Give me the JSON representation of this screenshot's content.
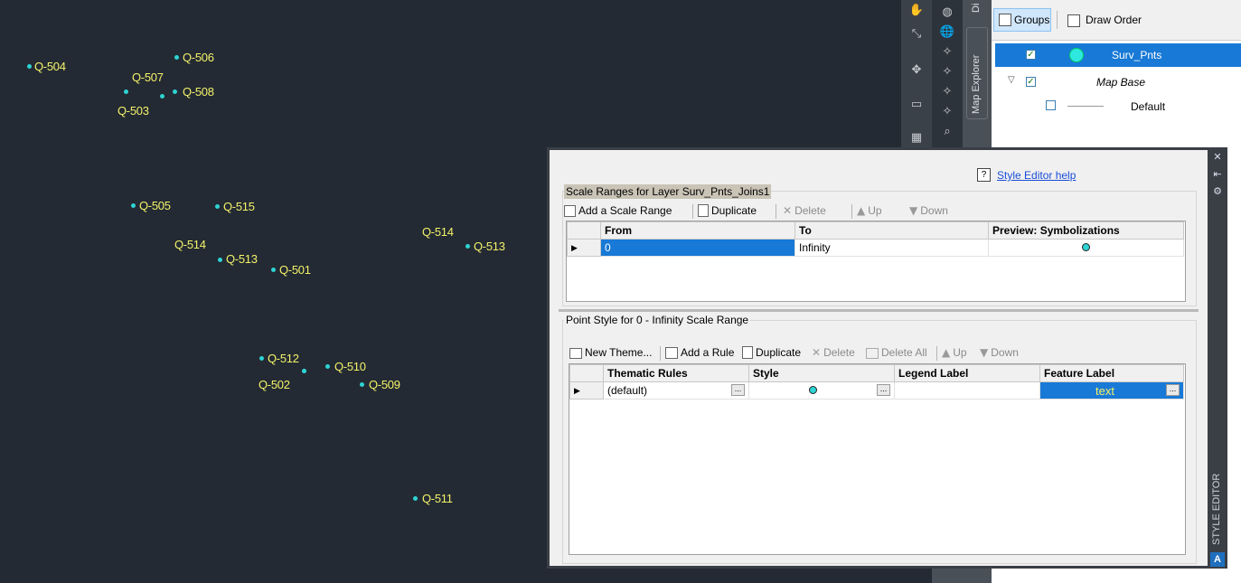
{
  "map": {
    "points": [
      {
        "label": "Q-504"
      },
      {
        "label": "Q-506"
      },
      {
        "label": "Q-507"
      },
      {
        "label": "Q-508"
      },
      {
        "label": "Q-503"
      },
      {
        "label": "Q-505"
      },
      {
        "label": "Q-515"
      },
      {
        "label": "Q-514"
      },
      {
        "label": "Q-513"
      },
      {
        "label": "Q-501"
      },
      {
        "label": "Q-514"
      },
      {
        "label": "Q-513"
      },
      {
        "label": "Q-512"
      },
      {
        "label": "Q-510"
      },
      {
        "label": "Q-502"
      },
      {
        "label": "Q-509"
      },
      {
        "label": "Q-511"
      }
    ],
    "point_color": "#2fd3d3",
    "label_color": "#f4f26a",
    "background": "#232a33"
  },
  "side_tabs": {
    "display_tab": "Di",
    "map_explorer_tab": "Map Explorer"
  },
  "layer_panel": {
    "groups_label": "Groups",
    "draw_order_label": "Draw Order",
    "rows": [
      {
        "label": "Surv_Pnts",
        "checked": true,
        "selected": true
      },
      {
        "label": "Map Base",
        "checked": true,
        "selected": false
      },
      {
        "label": "Default",
        "checked": false,
        "selected": false
      }
    ]
  },
  "style_editor": {
    "help_link": "Style Editor help",
    "help_icon": "?",
    "side_title": "STYLE EDITOR",
    "scale_section_title": "Scale Ranges for Layer Surv_Pnts_Joins1",
    "scale_toolbar": {
      "add": "Add a Scale Range",
      "duplicate": "Duplicate",
      "delete": "Delete",
      "up": "Up",
      "down": "Down"
    },
    "scale_columns": {
      "from": "From",
      "to": "To",
      "preview": "Preview: Symbolizations"
    },
    "scale_rows": [
      {
        "from": "0",
        "to": "Infinity"
      }
    ],
    "point_section_title": "Point Style for 0 - Infinity Scale Range",
    "point_toolbar": {
      "new_theme": "New Theme...",
      "add_rule": "Add a Rule",
      "duplicate": "Duplicate",
      "delete": "Delete",
      "delete_all": "Delete All",
      "up": "Up",
      "down": "Down"
    },
    "rule_columns": {
      "thematic": "Thematic Rules",
      "style": "Style",
      "legend": "Legend Label",
      "feature": "Feature Label"
    },
    "rule_rows": [
      {
        "thematic": "(default)",
        "legend": "",
        "feature": "text"
      }
    ],
    "ellipsis": "..."
  }
}
